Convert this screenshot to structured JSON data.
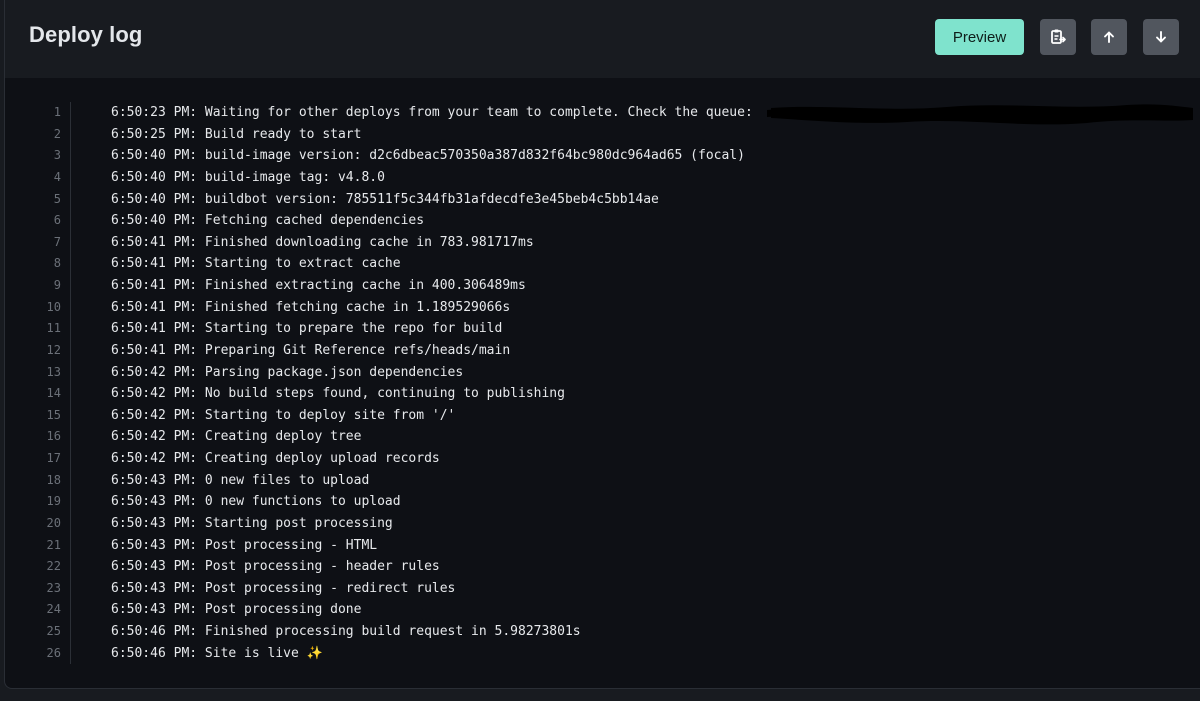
{
  "header": {
    "title": "Deploy log",
    "preview_label": "Preview",
    "icons": {
      "copy": "clipboard-copy-icon",
      "scroll_up": "arrow-up-icon",
      "scroll_down": "arrow-down-icon"
    }
  },
  "colors": {
    "background": "#0e1015",
    "header_bg": "#181b20",
    "accent": "#7fe3cd",
    "icon_button_bg": "#51565e",
    "text": "#e7e9ec",
    "line_number": "#6b7078"
  },
  "log": {
    "lines": [
      {
        "n": "1",
        "text": "6:50:23 PM: Waiting for other deploys from your team to complete. Check the queue:"
      },
      {
        "n": "2",
        "text": "6:50:25 PM: Build ready to start"
      },
      {
        "n": "3",
        "text": "6:50:40 PM: build-image version: d2c6dbeac570350a387d832f64bc980dc964ad65 (focal)"
      },
      {
        "n": "4",
        "text": "6:50:40 PM: build-image tag: v4.8.0"
      },
      {
        "n": "5",
        "text": "6:50:40 PM: buildbot version: 785511f5c344fb31afdecdfe3e45beb4c5bb14ae"
      },
      {
        "n": "6",
        "text": "6:50:40 PM: Fetching cached dependencies"
      },
      {
        "n": "7",
        "text": "6:50:41 PM: Finished downloading cache in 783.981717ms"
      },
      {
        "n": "8",
        "text": "6:50:41 PM: Starting to extract cache"
      },
      {
        "n": "9",
        "text": "6:50:41 PM: Finished extracting cache in 400.306489ms"
      },
      {
        "n": "10",
        "text": "6:50:41 PM: Finished fetching cache in 1.189529066s"
      },
      {
        "n": "11",
        "text": "6:50:41 PM: Starting to prepare the repo for build"
      },
      {
        "n": "12",
        "text": "6:50:41 PM: Preparing Git Reference refs/heads/main"
      },
      {
        "n": "13",
        "text": "6:50:42 PM: Parsing package.json dependencies"
      },
      {
        "n": "14",
        "text": "6:50:42 PM: No build steps found, continuing to publishing"
      },
      {
        "n": "15",
        "text": "6:50:42 PM: Starting to deploy site from '/'"
      },
      {
        "n": "16",
        "text": "6:50:42 PM: Creating deploy tree"
      },
      {
        "n": "17",
        "text": "6:50:42 PM: Creating deploy upload records"
      },
      {
        "n": "18",
        "text": "6:50:43 PM: 0 new files to upload"
      },
      {
        "n": "19",
        "text": "6:50:43 PM: 0 new functions to upload"
      },
      {
        "n": "20",
        "text": "6:50:43 PM: Starting post processing"
      },
      {
        "n": "21",
        "text": "6:50:43 PM: Post processing - HTML"
      },
      {
        "n": "22",
        "text": "6:50:43 PM: Post processing - header rules"
      },
      {
        "n": "23",
        "text": "6:50:43 PM: Post processing - redirect rules"
      },
      {
        "n": "24",
        "text": "6:50:43 PM: Post processing done"
      },
      {
        "n": "25",
        "text": "6:50:46 PM: Finished processing build request in 5.98273801s"
      },
      {
        "n": "26",
        "text": "6:50:46 PM: Site is live ✨"
      }
    ]
  }
}
